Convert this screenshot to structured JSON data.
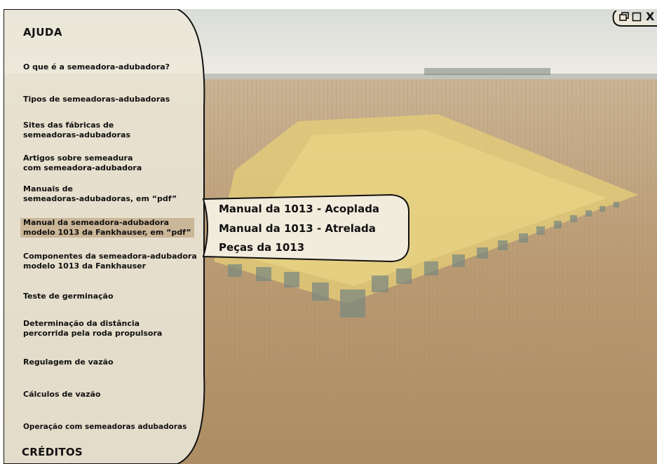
{
  "sidebar": {
    "title": "AJUDA",
    "items": [
      {
        "lines": [
          "O que é a semeadora-adubadora?"
        ]
      },
      {
        "lines": [
          "Tipos de semeadoras-adubadoras"
        ]
      },
      {
        "lines": [
          "Sites das fábricas de",
          "semeadoras-adubadoras"
        ]
      },
      {
        "lines": [
          "Artigos sobre semeadura",
          "com semeadora-adubadora"
        ]
      },
      {
        "lines": [
          "Manuais de",
          "semeadoras-adubadoras, em “pdf”"
        ]
      },
      {
        "lines": [
          "Manual da semeadora-adubadora",
          "modelo 1013 da Fankhauser, em “pdf”"
        ]
      },
      {
        "lines": [
          "Componentes da semeadora-adubadora",
          "modelo 1013 da Fankhauser"
        ]
      },
      {
        "lines": [
          "Teste de germinação"
        ]
      },
      {
        "lines": [
          "Determinação da distância",
          "percorrida pela roda propulsora"
        ]
      },
      {
        "lines": [
          "Regulagem de vazão"
        ]
      },
      {
        "lines": [
          "Cálculos de vazão"
        ]
      },
      {
        "lines": [
          "Operação com semeadoras adubadoras"
        ]
      }
    ],
    "credits": "CRÉDITOS"
  },
  "submenu": {
    "items": [
      "Manual da 1013 - Acoplada",
      "Manual da 1013 - Atrelada",
      "Peças da 1013"
    ]
  },
  "window_controls": {
    "restore_icon": "restore-icon",
    "maximize_icon": "maximize-icon",
    "close_label": "X"
  },
  "colors": {
    "panel": "#ece7d8",
    "highlight": "#c7ad84",
    "sky": "#e8e6de",
    "field": "#b89970"
  }
}
